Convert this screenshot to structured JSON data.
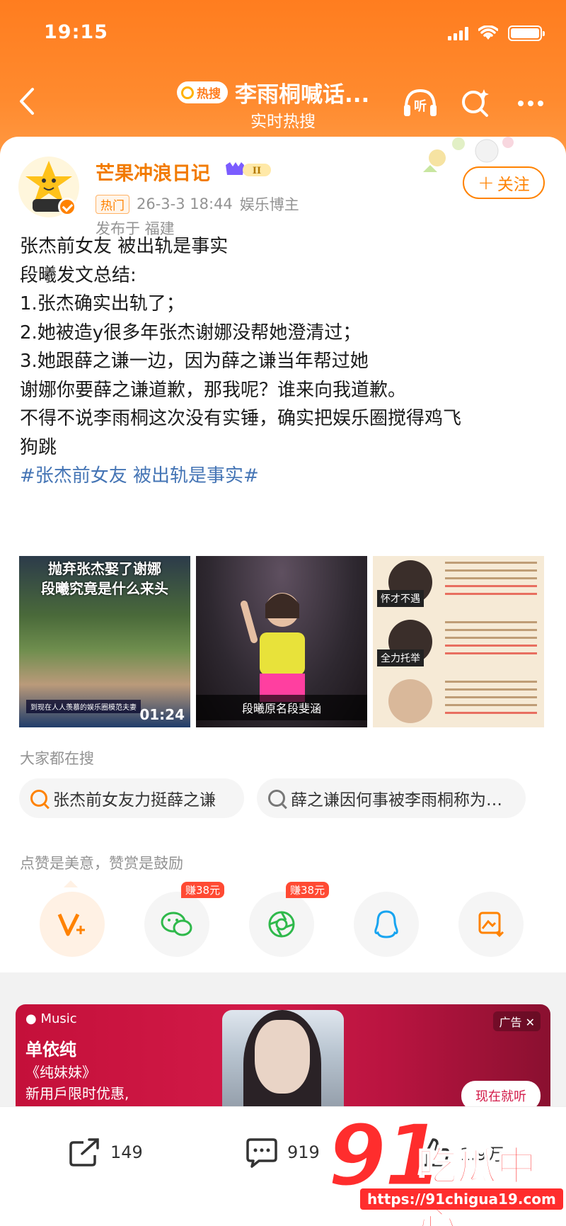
{
  "status_bar": {
    "time": "19:15"
  },
  "header": {
    "hot_tag": "热搜",
    "title": "李雨桐喊话...",
    "subtitle": "实时热搜",
    "listen_label": "听"
  },
  "post": {
    "username": "芒果冲浪日记",
    "level": "II",
    "hot_label": "热门",
    "date": "26-3-3 18:44",
    "role": "娱乐博主",
    "location": "发布于 福建",
    "follow_label": "关注",
    "text_lines": [
      "张杰前女友 被出轨是事实",
      "段曦发文总结:",
      "1.张杰确实出轨了；",
      "2.她被造y很多年张杰谢娜没帮她澄清过；",
      "3.她跟薛之谦一边，因为薛之谦当年帮过她",
      "谢娜你要薛之谦道歉，那我呢？谁来向我道歉。",
      "不得不说李雨桐这次没有实锤，确实把娱乐圈搅得鸡飞",
      "狗跳"
    ],
    "hashtag": "#张杰前女友 被出轨是事实#",
    "images": [
      {
        "caption_top": "抛弃张杰娶了谢娜\n段曦究竟是什么来头",
        "caption_bottom": "到现在人人羡慕的娱乐圈模范夫妻",
        "duration": "01:24"
      },
      {
        "caption": "段曦原名段斐涵"
      },
      {
        "badge1": "怀才不遇",
        "badge2": "全力托举"
      }
    ]
  },
  "search": {
    "hint": "大家都在搜",
    "chips": [
      "张杰前女友力挺薛之谦",
      "薛之谦因何事被李雨桐称为…"
    ]
  },
  "share": {
    "hint": "点赞是美意，赞赏是鼓励",
    "earn_wechat": "赚38元",
    "earn_moments": "赚38元"
  },
  "ad": {
    "brand": "Music",
    "artist": "单依纯",
    "song": "《纯妹妹》",
    "promo": "新用戶限时优惠,",
    "tag": "广告",
    "cta": "现在就听"
  },
  "bottom_bar": {
    "reposts": "149",
    "comments": "919",
    "likes": "1.9万"
  },
  "watermark": {
    "big": "91",
    "cn": "吃瓜中心",
    "url": "https://91chigua19.com"
  },
  "colors": {
    "header": "#ff7d1f",
    "accent": "#ff8200",
    "hashtag": "#4575b5"
  }
}
